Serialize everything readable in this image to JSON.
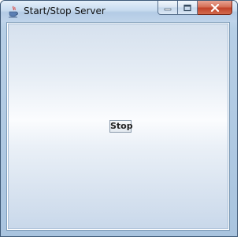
{
  "window": {
    "title": "Start/Stop Server",
    "app_icon": "java-cup-icon",
    "controls": {
      "minimize_icon": "minimize-icon",
      "maximize_icon": "maximize-icon",
      "close_icon": "close-icon"
    }
  },
  "main": {
    "stop_button_label": "Stop"
  },
  "colors": {
    "close_button": "#c9472c",
    "frame": "#a9c4df",
    "content_edge": "#c9d8ea",
    "content_center": "#fbfcfe"
  }
}
